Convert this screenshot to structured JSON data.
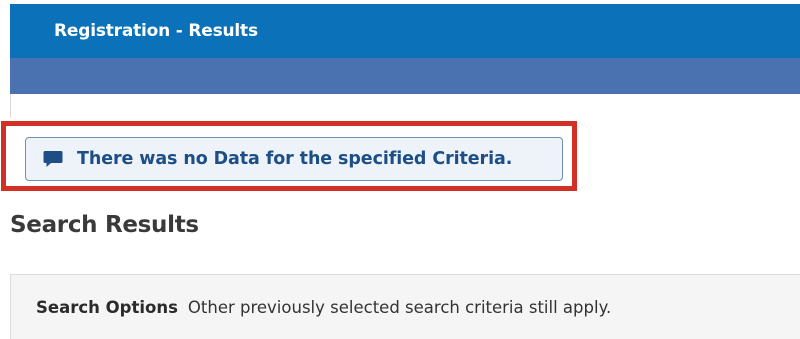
{
  "header": {
    "title": "Registration - Results"
  },
  "alert": {
    "icon": "comment-icon",
    "message": "There was no Data for the specified Criteria."
  },
  "results": {
    "title": "Search Results"
  },
  "search_options": {
    "label": "Search Options",
    "text": "Other previously selected search criteria still apply."
  },
  "colors": {
    "header_bg": "#0b72b9",
    "subbar_bg": "#4a72b0",
    "alert_text": "#1d4f86",
    "highlight": "#d22f27"
  }
}
